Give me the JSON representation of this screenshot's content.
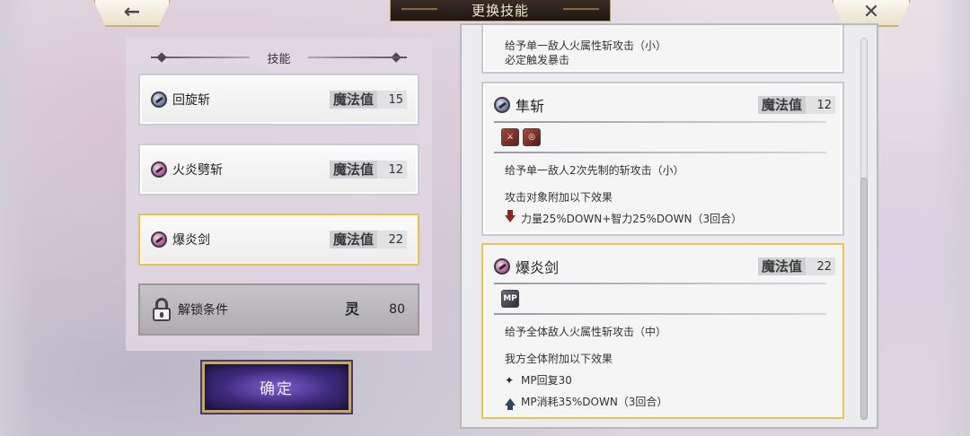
{
  "header": {
    "title": "更换技能",
    "back_icon": "←",
    "close_icon": "✕"
  },
  "skill_list": {
    "header": "技能",
    "items": [
      {
        "name": "回旋斩",
        "mp_label": "魔法值",
        "mp": "15",
        "orb": "blue",
        "selected": false
      },
      {
        "name": "火炎劈斩",
        "mp_label": "魔法值",
        "mp": "12",
        "orb": "pink",
        "selected": false
      },
      {
        "name": "爆炎剑",
        "mp_label": "魔法值",
        "mp": "22",
        "orb": "pink",
        "selected": true
      }
    ],
    "locked": {
      "label": "解锁条件",
      "cost_icon": "灵",
      "cost": "80"
    }
  },
  "confirm_label": "确定",
  "details": {
    "partial_card": {
      "line1": "给予单一敌人火属性斩攻击（小）",
      "line2": "必定触发暴击"
    },
    "card1": {
      "title": "隼斩",
      "mp_label": "魔法值",
      "mp": "12",
      "desc": "给予单一敌人2次先制的斩攻击（小）",
      "effect_header": "攻击对象附加以下效果",
      "effects": [
        {
          "text": "力量25%DOWN+智力25%DOWN（3回合）",
          "icon": "arrow-down"
        }
      ]
    },
    "card2": {
      "title": "爆炎剑",
      "mp_label": "魔法值",
      "mp": "22",
      "tag": "MP",
      "desc": "给予全体敌人火属性斩攻击（中）",
      "effect_header": "我方全体附加以下效果",
      "effects": [
        {
          "text": "MP回复30",
          "icon": "sparkle"
        },
        {
          "text": "MP消耗35%DOWN（3回合）",
          "icon": "arrow-up"
        }
      ]
    }
  }
}
